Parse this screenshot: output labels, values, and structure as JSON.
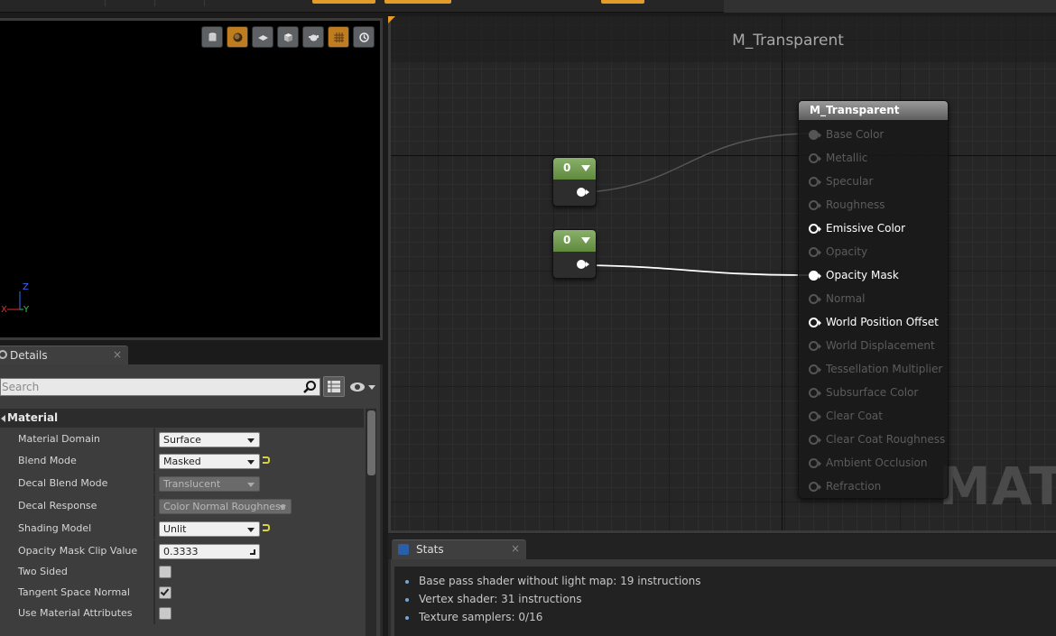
{
  "graph": {
    "title": "M_Transparent",
    "watermark": "MATE",
    "constants": [
      {
        "value": "0"
      },
      {
        "value": "0"
      }
    ],
    "material_node": {
      "title": "M_Transparent",
      "pins": [
        {
          "label": "Base Color",
          "state": "semi"
        },
        {
          "label": "Metallic",
          "state": "inactive"
        },
        {
          "label": "Specular",
          "state": "inactive"
        },
        {
          "label": "Roughness",
          "state": "inactive"
        },
        {
          "label": "Emissive Color",
          "state": "active"
        },
        {
          "label": "Opacity",
          "state": "inactive"
        },
        {
          "label": "Opacity Mask",
          "state": "filled"
        },
        {
          "label": "Normal",
          "state": "inactive"
        },
        {
          "label": "World Position Offset",
          "state": "active"
        },
        {
          "label": "World Displacement",
          "state": "inactive"
        },
        {
          "label": "Tessellation Multiplier",
          "state": "inactive"
        },
        {
          "label": "Subsurface Color",
          "state": "inactive"
        },
        {
          "label": "Clear Coat",
          "state": "inactive"
        },
        {
          "label": "Clear Coat Roughness",
          "state": "inactive"
        },
        {
          "label": "Ambient Occlusion",
          "state": "inactive"
        },
        {
          "label": "Refraction",
          "state": "inactive"
        }
      ]
    }
  },
  "viewport": {
    "axes": {
      "z": "Z",
      "x": "X",
      "y": "Y"
    },
    "toolbar": [
      "cylinder-icon",
      "sphere-icon",
      "plane-icon",
      "cube-icon",
      "teapot-icon",
      "grid-icon",
      "realtime-icon"
    ]
  },
  "details": {
    "tab_label": "Details",
    "close": "×",
    "search_placeholder": "Search",
    "category": "Material",
    "properties": [
      {
        "name": "Material Domain",
        "type": "combo",
        "value": "Surface"
      },
      {
        "name": "Blend Mode",
        "type": "combo",
        "value": "Masked",
        "reset": true
      },
      {
        "name": "Decal Blend Mode",
        "type": "combo-disabled",
        "value": "Translucent"
      },
      {
        "name": "Decal Response",
        "type": "combo-disabled-wide",
        "value": "Color Normal Roughness"
      },
      {
        "name": "Shading Model",
        "type": "combo",
        "value": "Unlit",
        "reset": true
      },
      {
        "name": "Opacity Mask Clip Value",
        "type": "number",
        "value": "0.3333"
      },
      {
        "name": "Two Sided",
        "type": "check",
        "checked": false
      },
      {
        "name": "Tangent Space Normal",
        "type": "check",
        "checked": true
      },
      {
        "name": "Use Material Attributes",
        "type": "check",
        "checked": false
      }
    ]
  },
  "stats": {
    "tab_label": "Stats",
    "close": "×",
    "lines": [
      "Base pass shader without light map: 19 instructions",
      "Vertex shader: 31 instructions",
      "Texture samplers: 0/16"
    ]
  },
  "colors": {
    "accent": "#e39b29",
    "constant_header": "#6f9a4b",
    "axis_x": "#e03030",
    "axis_y": "#3ec43e",
    "axis_z": "#3a6cff"
  }
}
